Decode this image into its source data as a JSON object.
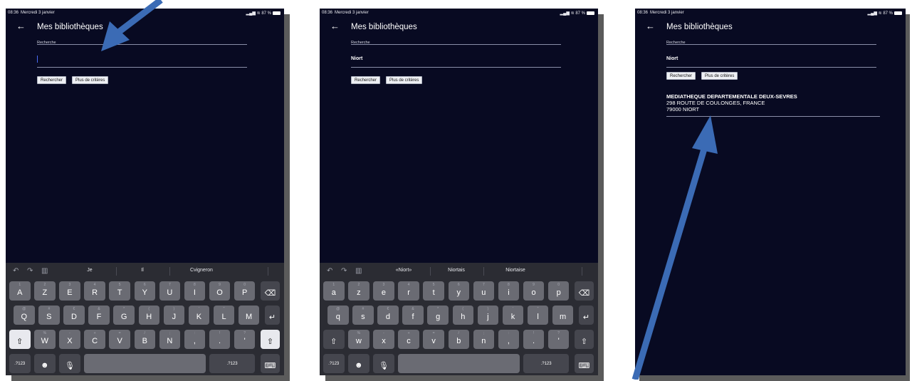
{
  "screens": [
    {
      "status": {
        "time": "08:36",
        "date": "Mercredi 3 janvier",
        "battery": "87 %"
      },
      "header": {
        "back_icon": "←",
        "title": "Mes bibliothèques"
      },
      "search": {
        "label": "Recherche",
        "value": ""
      },
      "buttons": {
        "search": "Rechercher",
        "more": "Plus de critères"
      },
      "keyboard": {
        "suggestions": [
          "Je",
          "Il",
          "Cvigneron"
        ],
        "row1": [
          "A",
          "Z",
          "E",
          "R",
          "T",
          "Y",
          "U",
          "I",
          "O",
          "P"
        ],
        "row1_hints": [
          "1",
          "2",
          "3",
          "4",
          "5",
          "6",
          "7",
          "8",
          "9",
          "0"
        ],
        "row2": [
          "Q",
          "S",
          "D",
          "F",
          "G",
          "H",
          "J",
          "K",
          "L",
          "M"
        ],
        "row2_hints": [
          "@",
          "#",
          "€",
          "&",
          "*",
          "(",
          ")",
          "'",
          "\"",
          ""
        ],
        "row3": [
          "W",
          "X",
          "C",
          "V",
          "B",
          "N",
          ",",
          ".",
          "'"
        ],
        "row3_hints": [
          "%",
          "-",
          "+",
          "=",
          "/",
          ";",
          ":",
          "!",
          "?"
        ],
        "num_label": ".?123"
      }
    },
    {
      "status": {
        "time": "08:36",
        "date": "Mercredi 3 janvier",
        "battery": "87 %"
      },
      "header": {
        "back_icon": "←",
        "title": "Mes bibliothèques"
      },
      "search": {
        "label": "Recherche",
        "value": "Niort"
      },
      "buttons": {
        "search": "Rechercher",
        "more": "Plus de critères"
      },
      "keyboard": {
        "suggestions": [
          "«Niort»",
          "Niortais",
          "Niortaise"
        ],
        "row1": [
          "a",
          "z",
          "e",
          "r",
          "t",
          "y",
          "u",
          "i",
          "o",
          "p"
        ],
        "row1_hints": [
          "1",
          "2",
          "3",
          "4",
          "5",
          "6",
          "7",
          "8",
          "9",
          "0"
        ],
        "row2": [
          "q",
          "s",
          "d",
          "f",
          "g",
          "h",
          "j",
          "k",
          "l",
          "m"
        ],
        "row2_hints": [
          "@",
          "#",
          "€",
          "&",
          "*",
          "(",
          ")",
          "'",
          "\"",
          ""
        ],
        "row3": [
          "w",
          "x",
          "c",
          "v",
          "b",
          "n",
          ",",
          ".",
          "'"
        ],
        "row3_hints": [
          "%",
          "-",
          "+",
          "=",
          "/",
          ";",
          ":",
          "!",
          "?"
        ],
        "num_label": ".?123"
      }
    },
    {
      "status": {
        "time": "08:36",
        "date": "Mercredi 3 janvier",
        "battery": "87 %"
      },
      "header": {
        "back_icon": "←",
        "title": "Mes bibliothèques"
      },
      "search": {
        "label": "Recherche",
        "value": "Niort"
      },
      "buttons": {
        "search": "Rechercher",
        "more": "Plus de critères"
      },
      "result": {
        "name": "MEDIATHEQUE DEPARTEMENTALE DEUX-SEVRES",
        "address": "298 ROUTE DE COULONGES, FRANCE",
        "city": "79000 NIORT"
      }
    }
  ],
  "colors": {
    "screen_bg": "#080a22",
    "keyboard_bg": "#2b2c33",
    "key": "#6a6b73",
    "arrow": "#3b6bb5"
  }
}
